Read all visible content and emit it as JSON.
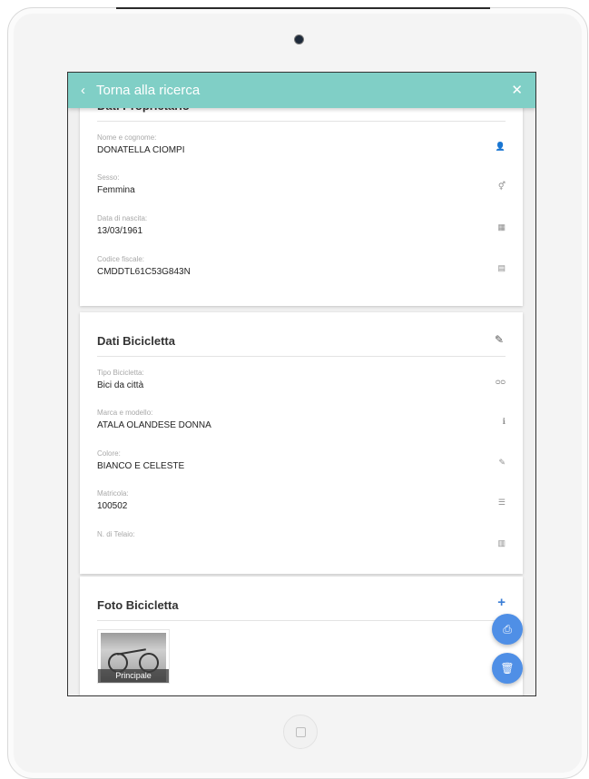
{
  "appbar": {
    "back_label": "Torna alla ricerca",
    "back_icon": "chevron-left-icon",
    "close_icon": "close-icon"
  },
  "owner_card": {
    "title": "Dati Proprietario",
    "fields": [
      {
        "label": "Nome e cognome:",
        "value": "DONATELLA CIOMPI",
        "icon": "user-icon",
        "glyph": "👤"
      },
      {
        "label": "Sesso:",
        "value": "Femmina",
        "icon": "gender-icon",
        "glyph": "⚥"
      },
      {
        "label": "Data di nascita:",
        "value": "13/03/1961",
        "icon": "calendar-icon",
        "glyph": "▦"
      },
      {
        "label": "Codice fiscale:",
        "value": "CMDDTL61C53G843N",
        "icon": "calculator-icon",
        "glyph": "▤"
      }
    ]
  },
  "bike_card": {
    "title": "Dati Bicicletta",
    "edit_icon": "pencil-icon",
    "fields": [
      {
        "label": "Tipo Bicicletta:",
        "value": "Bici da città",
        "icon": "bicycle-icon",
        "glyph": "ᴑᴑ"
      },
      {
        "label": "Marca e modello:",
        "value": "ATALA OLANDESE DONNA",
        "icon": "info-icon",
        "glyph": "ℹ"
      },
      {
        "label": "Colore:",
        "value": "BIANCO E CELESTE",
        "icon": "paintbrush-icon",
        "glyph": "✎"
      },
      {
        "label": "Matricola:",
        "value": "100502",
        "icon": "list-icon",
        "glyph": "☰"
      },
      {
        "label": "N. di Telaio:",
        "value": "",
        "icon": "barcode-icon",
        "glyph": "▥"
      }
    ]
  },
  "photo_card": {
    "title": "Foto Bicicletta",
    "add_icon": "plus-icon",
    "photos": [
      {
        "caption": "Principale"
      }
    ]
  },
  "fabs": {
    "print_icon": "printer-icon",
    "delete_icon": "trash-icon"
  },
  "colors": {
    "appbar": "#80cfc6",
    "fab": "#4f8fe6",
    "accent": "#3b7ed6"
  }
}
